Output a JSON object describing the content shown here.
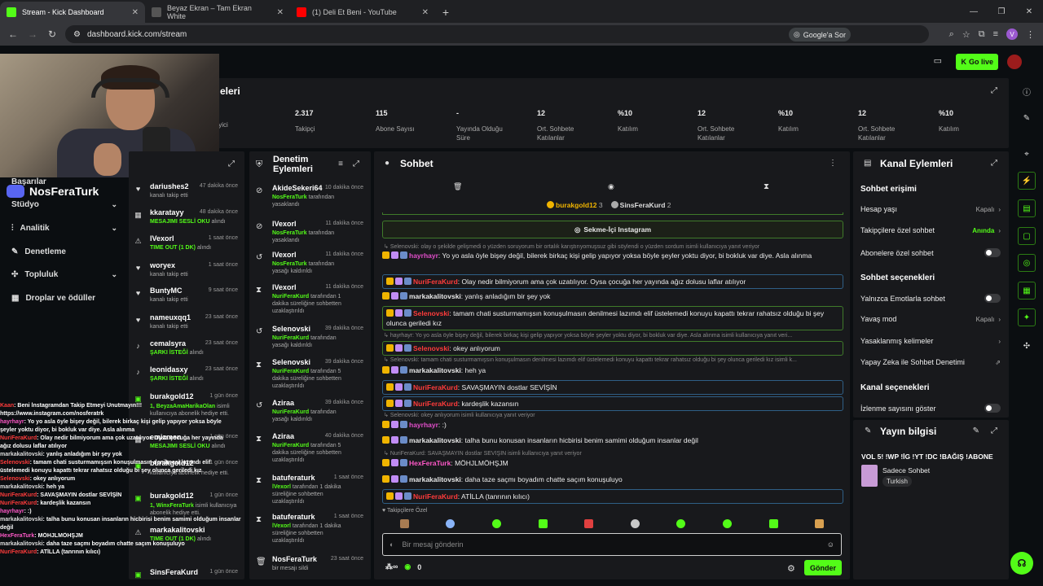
{
  "browser": {
    "tabs": [
      {
        "title": "Stream - Kick Dashboard",
        "color": "#53fc18"
      },
      {
        "title": "Beyaz Ekran – Tam Ekran White",
        "color": "#444444"
      },
      {
        "title": "(1) Deli Et Beni - YouTube",
        "color": "#ff0000"
      }
    ],
    "url": "dashboard.kick.com/stream",
    "google_label": "Google'a Sor",
    "profile_initial": "V"
  },
  "header": {
    "golive_label": "Go live"
  },
  "stats_title": "eleri",
  "stats": [
    {
      "value": "",
      "label": "leyici"
    },
    {
      "value": "2.317",
      "label": "Takipçi"
    },
    {
      "value": "115",
      "label": "Abone Sayısı"
    },
    {
      "value": "-",
      "label": "Yayında Olduğu Süre"
    },
    {
      "value": "12",
      "label": "Ort. Sohbete Katılanlar"
    },
    {
      "value": "%10",
      "label": "Katılım"
    },
    {
      "value": "12",
      "label": "Ort. Sohbete Katılanlar"
    },
    {
      "value": "%10",
      "label": "Katılım"
    },
    {
      "value": "12",
      "label": "Ort. Sohbete Katılanlar"
    },
    {
      "value": "%10",
      "label": "Katılım"
    }
  ],
  "sidebar": {
    "discord_name": "NosFeraTurk",
    "items": [
      {
        "label": "Başarılar"
      },
      {
        "label": "Stüdyo"
      },
      {
        "label": "Analitik"
      },
      {
        "label": "Denetleme"
      },
      {
        "label": "Topluluk"
      },
      {
        "label": "Droplar ve ödüller"
      }
    ]
  },
  "activity": [
    {
      "name": "dariushes2",
      "time": "47 dakika önce",
      "desc": "kanalı takip etti",
      "hl": ""
    },
    {
      "name": "kkaratayy",
      "time": "48 dakika önce",
      "desc": "alındı",
      "hl": "MESAJIMI SESLİ OKU"
    },
    {
      "name": "lVexorl",
      "time": "1 saat önce",
      "desc": "alındı",
      "hl": "TIME OUT (1 DK)"
    },
    {
      "name": "woryex",
      "time": "1 saat önce",
      "desc": "kanalı takip etti",
      "hl": ""
    },
    {
      "name": "BuntyMC",
      "time": "9 saat önce",
      "desc": "kanalı takip etti",
      "hl": ""
    },
    {
      "name": "nameuxqq1",
      "time": "23 saat önce",
      "desc": "kanalı takip etti",
      "hl": ""
    },
    {
      "name": "cemalsyra",
      "time": "23 saat önce",
      "desc": "alındı",
      "hl": "ŞARKI İSTEĞİ"
    },
    {
      "name": "leonidasxy",
      "time": "23 saat önce",
      "desc": "alındı",
      "hl": "ŞARKI İSTEĞİ"
    },
    {
      "name": "burakgold12",
      "time": "1 gün önce",
      "desc": "isimli kullanıcıya abonelik hediye etti.",
      "hl": "1, BeyzaAmaHarikaOlan"
    },
    {
      "name": "emizmen",
      "time": "1 gün önce",
      "desc": "alındı",
      "hl": "MESAJIMI SESLİ OKU"
    },
    {
      "name": "burakgold12",
      "time": "1 gün önce",
      "desc": "kullanıcıya abonelik hediye etti.",
      "hl": ""
    },
    {
      "name": "burakgold12",
      "time": "1 gün önce",
      "desc": "isimli kullanıcıya abonelik hediye etti.",
      "hl": "1, WinxFeraTurk"
    },
    {
      "name": "markakalitovski",
      "time": "",
      "desc": "alındı",
      "hl": "TIME OUT (1 DK)"
    },
    {
      "name": "SinsFeraKurd",
      "time": "1 gün önce",
      "desc": "",
      "hl": ""
    }
  ],
  "moderation": {
    "title": "Denetim Eylemleri",
    "items": [
      {
        "name": "AkideSekeri64",
        "time": "10 dakika önce",
        "actor": "NosFeraTurk",
        "desc": "tarafından yasaklandı"
      },
      {
        "name": "lVexorl",
        "time": "11 dakika önce",
        "actor": "NosFeraTurk",
        "desc": "tarafından yasaklandı"
      },
      {
        "name": "lVexorl",
        "time": "11 dakika önce",
        "actor": "NosFeraTurk",
        "desc": "tarafından yasağı kaldırıldı"
      },
      {
        "name": "lVexorl",
        "time": "11 dakika önce",
        "actor": "NuriFeraKurd",
        "desc": "tarafından 1 dakika süreliğine sohbetten uzaklaştırıldı"
      },
      {
        "name": "Selenovski",
        "time": "39 dakika önce",
        "actor": "NuriFeraKurd",
        "desc": "tarafından yasağı kaldırıldı"
      },
      {
        "name": "Selenovski",
        "time": "39 dakika önce",
        "actor": "NuriFeraKurd",
        "desc": "tarafından 5 dakika süreliğine sohbetten uzaklaştırıldı"
      },
      {
        "name": "Aziraa",
        "time": "39 dakika önce",
        "actor": "NuriFeraKurd",
        "desc": "tarafından yasağı kaldırıldı"
      },
      {
        "name": "Aziraa",
        "time": "40 dakika önce",
        "actor": "NuriFeraKurd",
        "desc": "tarafından 5 dakika süreliğine sohbetten uzaklaştırıldı"
      },
      {
        "name": "batuferaturk",
        "time": "1 saat önce",
        "actor": "lVexorl",
        "desc": "tarafından 1 dakika süreliğine sohbetten uzaklaştırıldı"
      },
      {
        "name": "batuferaturk",
        "time": "1 saat önce",
        "actor": "lVexorl",
        "desc": "tarafından 1 dakika süreliğine sohbetten uzaklaştırıldı"
      },
      {
        "name": "NosFeraTurk",
        "time": "23 saat önce",
        "actor": "",
        "desc": "bir mesajı sildi"
      }
    ]
  },
  "chat": {
    "title": "Sohbet",
    "top_users": [
      {
        "name": "burakgold12",
        "count": "3"
      },
      {
        "name": "SinsFeraKurd",
        "count": "2"
      }
    ],
    "pinned_label": "Sekme-İçi Instagram",
    "messages": [
      {
        "reply": "Selenovski: olay o şekilde gelişmedi o yüzden soruyorum bir ortalık karıştırıyomuşsuz gibi söylendi o yüzden sordum isimli kullanıcıya yanıt veriyor",
        "user": "hayrhayr",
        "ucolor": "#e04ec9",
        "text": ": Yo yo asla öyle bişey değil, bilerek birkaç kişi gelip yapıyor yoksa böyle şeyler yoktu diyor, bi bokluk var diye. Asla alınma",
        "box": ""
      },
      {
        "reply": "",
        "user": "NuriFeraKurd",
        "ucolor": "#ff3b3b",
        "text": ": Olay nedir bilmiyorum ama çok uzatılıyor. Oysa çocuğa her yayında ağız dolusu laflar atılıyor",
        "box": "blue"
      },
      {
        "reply": "",
        "user": "markakalitovski",
        "ucolor": "#e8e8e8",
        "text": ": yanlış anladığım bir şey yok",
        "box": ""
      },
      {
        "reply": "",
        "user": "Selenovski",
        "ucolor": "#ff3b3b",
        "text": ": tamam chati susturmamışsın konuşulmasın denilmesi lazımdı elif üstelemedi konuyu kapattı tekrar rahatsız olduğu bi şey olunca geriledi kız",
        "box": "green"
      },
      {
        "reply": "hayrhayr: Yo yo asla öyle bişey değil, bilerek birkaç kişi gelip yapıyor yoksa böyle şeyler yoktu diyor, bi bokluk var diye. Asla alınma isimli kullanıcıya yanıt veri...",
        "user": "Selenovski",
        "ucolor": "#ff3b3b",
        "text": ": okey anlıyorum",
        "box": "green"
      },
      {
        "reply": "Selenovski: tamam chati susturmamışsın konuşulmasın denilmesi lazımdı elif üstelemedi konuyu kapattı tekrar rahatsız olduğu bi şey olunca geriledi kız isimli k...",
        "user": "markakalitovski",
        "ucolor": "#e8e8e8",
        "text": ": heh ya",
        "box": ""
      },
      {
        "reply": "",
        "user": "NuriFeraKurd",
        "ucolor": "#ff3b3b",
        "text": ": SAVAŞMAYIN dostlar SEVİŞİN",
        "box": "blue"
      },
      {
        "reply": "",
        "user": "NuriFeraKurd",
        "ucolor": "#ff3b3b",
        "text": ": kardeşlik kazansın",
        "box": "blue"
      },
      {
        "reply": "Selenovski: okey anlıyorum isimli kullanıcıya yanıt veriyor",
        "user": "hayrhayr",
        "ucolor": "#e04ec9",
        "text": ": :)",
        "box": ""
      },
      {
        "reply": "",
        "user": "markakalitovski",
        "ucolor": "#e8e8e8",
        "text": ": talha bunu konusan insanların hicbirisi benim samimi olduğum insanlar değil",
        "box": ""
      },
      {
        "reply": "NuriFeraKurd: SAVAŞMAYIN dostlar SEVİŞİN isimli kullanıcıya yanıt veriyor",
        "user": "HexFeraTurk",
        "ucolor": "#ff58c8",
        "text": ": MÖHJLMÖHŞJM",
        "box": ""
      },
      {
        "reply": "",
        "user": "markakalitovski",
        "ucolor": "#e8e8e8",
        "text": ": daha taze saçmı boyadım chatte saçım konuşuluyo",
        "box": ""
      },
      {
        "reply": "",
        "user": "NuriFeraKurd",
        "ucolor": "#ff3b3b",
        "text": ": ATİLLA (tanrının kılıcı)",
        "box": "blue"
      }
    ],
    "followers_label": "Takipçilere Özel",
    "input_placeholder": "Bir mesaj gönderin",
    "points": "0",
    "send_label": "Gönder"
  },
  "channel": {
    "title": "Kanal Eylemleri",
    "sec1": "Sohbet erişimi",
    "rows1": [
      {
        "label": "Hesap yaşı",
        "value": "Kapalı",
        "type": "select"
      },
      {
        "label": "Takipçilere özel sohbet",
        "value": "Anında",
        "type": "select"
      },
      {
        "label": "Abonelere özel sohbet",
        "value": "",
        "type": "toggle"
      }
    ],
    "sec2": "Sohbet seçenekleri",
    "rows2": [
      {
        "label": "Yalnızca Emotlarla sohbet",
        "value": "",
        "type": "toggle"
      },
      {
        "label": "Yavaş mod",
        "value": "Kapalı",
        "type": "select"
      },
      {
        "label": "Yasaklanmış kelimeler",
        "value": "",
        "type": "select"
      },
      {
        "label": "Yapay Zeka ile Sohbet Denetimi",
        "value": "",
        "type": "link"
      }
    ],
    "sec3": "Kanal seçenekleri",
    "rows3": [
      {
        "label": "İzlenme sayısını göster",
        "value": "",
        "type": "toggle"
      }
    ]
  },
  "stream_info": {
    "title": "Yayın bilgisi",
    "stream_title": "VOL 5! !WP !İG !YT !DC !BAĞIŞ !ABONE",
    "category": "Sadece Sohbet",
    "tag": "Turkish"
  },
  "overlay_chat": [
    {
      "user": "Kaan",
      "text": "Beni İnstagramdan Takip Etmeyi Unutmayın!!!"
    },
    {
      "user": "",
      "text": "https://www.instagram.com/nosferatrk"
    },
    {
      "user": "hayrhayr",
      "text": "Yo yo asla öyle bişey değil, bilerek birkaç kişi gelip yapıyor yoksa böyle"
    },
    {
      "user": "",
      "text": "şeyler yoktu diyor, bi bokluk var diye. Asla alınma"
    },
    {
      "user": "NuriFeraKurd",
      "text": "Olay nedir bilmiyorum ama çok uzatılıyor. Oysa çocuğa her yayında"
    },
    {
      "user": "",
      "text": "ağız dolusu laflar atılıyor"
    },
    {
      "user": "markakalitovski",
      "text": "yanlış anladığım bir şey yok"
    },
    {
      "user": "Selenovski",
      "text": "tamam chati susturmamışsın konuşulmasın denilmesi lazımdı elif"
    },
    {
      "user": "",
      "text": "üstelemedi konuyu kapattı tekrar rahatsız olduğu bi şey olunca geriledi kız"
    },
    {
      "user": "Selenovski",
      "text": "okey anlıyorum"
    },
    {
      "user": "markakalitovski",
      "text": "heh ya"
    },
    {
      "user": "NuriFeraKurd",
      "text": "SAVAŞMAYIN dostlar SEVİŞİN"
    },
    {
      "user": "NuriFeraKurd",
      "text": "kardeşlik kazansın"
    },
    {
      "user": "hayrhayr",
      "text": ":)"
    },
    {
      "user": "markakalitovski",
      "text": "talha bunu konusan insanların hicbirisi benim samimi olduğum insanlar"
    },
    {
      "user": "",
      "text": "değil"
    },
    {
      "user": "HexFeraTurk",
      "text": "MÖHJLMÖHŞJM"
    },
    {
      "user": "markakalitovski",
      "text": "daha taze saçmı boyadım chatte saçım konuşuluyo"
    },
    {
      "user": "NuriFeraKurd",
      "text": "ATİLLA (tanrının kılıcı)"
    }
  ],
  "colors": {
    "accent": "#53fc18",
    "panel": "#18191c",
    "bg": "#0b0e11"
  }
}
